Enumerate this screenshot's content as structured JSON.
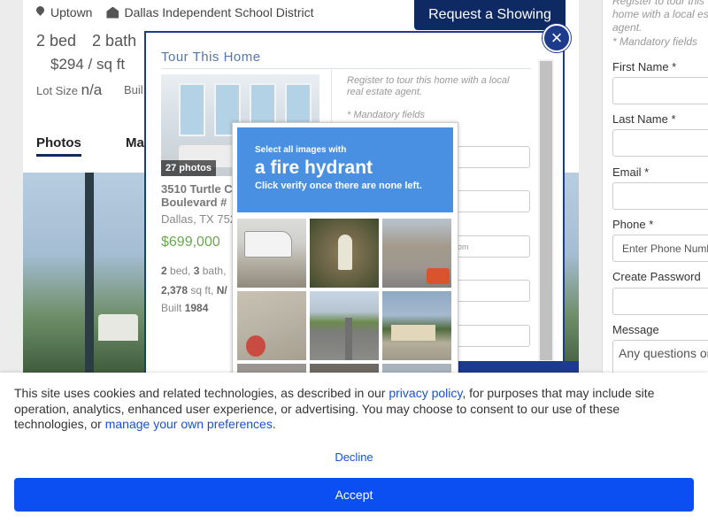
{
  "listing": {
    "neighborhood": "Uptown",
    "school_district": "Dallas Independent School District",
    "request_button": "Request a Showing",
    "beds": "2 bed",
    "baths": "2 bath",
    "price_per_sqft": "$294 / sq ft",
    "lot_label": "Lot Size",
    "lot_value": "n/a",
    "built_label": "Buil",
    "tabs": {
      "photos": "Photos",
      "map": "Ma"
    }
  },
  "sidebar": {
    "note": "Register to tour this home with a local estate agent.",
    "mandatory": "* Mandatory fields",
    "first_name_label": "First Name *",
    "last_name_label": "Last Name *",
    "email_label": "Email *",
    "phone_label": "Phone *",
    "phone_placeholder": "Enter Phone Number",
    "password_label": "Create Password",
    "message_label": "Message",
    "message_placeholder": "Any questions or"
  },
  "modal": {
    "title": "Tour This Home",
    "close_glyph": "×",
    "photo_count": "27 photos",
    "address_line1": "3510 Turtle C",
    "address_line2": "Boulevard #",
    "city": "Dallas, TX 752",
    "price": "$699,000",
    "beds": "2",
    "beds_suffix": " bed, ",
    "baths": "3",
    "baths_suffix": " bath,",
    "sqft": "2,378",
    "sqft_suffix": " sq ft, ",
    "sqft_trail": "N/",
    "built_label": "Built ",
    "built_year": "1984",
    "note": "Register to tour this home with a local real estate agent.",
    "mandatory": "* Mandatory fields",
    "email_placeholder_fragment": "ail.com"
  },
  "captcha": {
    "prompt_small": "Select all images with",
    "target": "a fire hydrant",
    "instruction": "Click verify once there are none left."
  },
  "cookie": {
    "text_before_link": "This site uses cookies and related technologies, as described in our ",
    "privacy_link": "privacy policy",
    "text_middle": ", for purposes that may include site operation, analytics, enhanced user experience, or advertising. You may choose to consent to our use of these technologies, or ",
    "preferences_link": "manage your own preferences",
    "text_end": ".",
    "decline": "Decline",
    "accept": "Accept"
  },
  "colors": {
    "navy": "#0f2a63",
    "modal_border": "#1d3b8c",
    "captcha_blue": "#4a90e2",
    "accept_blue": "#0b4ff2",
    "link_blue": "#1652d6",
    "price_green": "#6aa84f"
  }
}
